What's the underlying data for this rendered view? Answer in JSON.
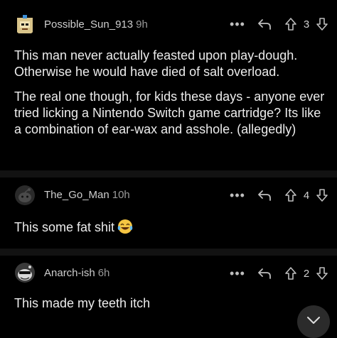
{
  "comments": [
    {
      "username": "Possible_Sun_913",
      "age": "9h",
      "score": "3",
      "paragraphs": [
        "This man never actually feasted upon play-dough. Otherwise he would have died of salt overload.",
        "The real one though, for kids these days - anyone ever tried licking a Nintendo Switch game cartridge? Its like a combination of ear-wax and asshole. (allegedly)"
      ]
    },
    {
      "username": "The_Go_Man",
      "age": "10h",
      "score": "4",
      "text": "This some fat shit",
      "emoji": "laughing-crying-emoji"
    },
    {
      "username": "Anarch-ish",
      "age": "6h",
      "score": "2",
      "text": "This made my teeth itch"
    }
  ],
  "icons": {
    "more": "more-options-icon",
    "reply": "reply-icon",
    "upvote": "upvote-icon",
    "downvote": "downvote-icon",
    "fab": "collapse-chevron-icon"
  },
  "colors": {
    "background": "#000000",
    "divider": "#121212",
    "text": "#e8e8e8",
    "muted": "#9a9a9a"
  }
}
